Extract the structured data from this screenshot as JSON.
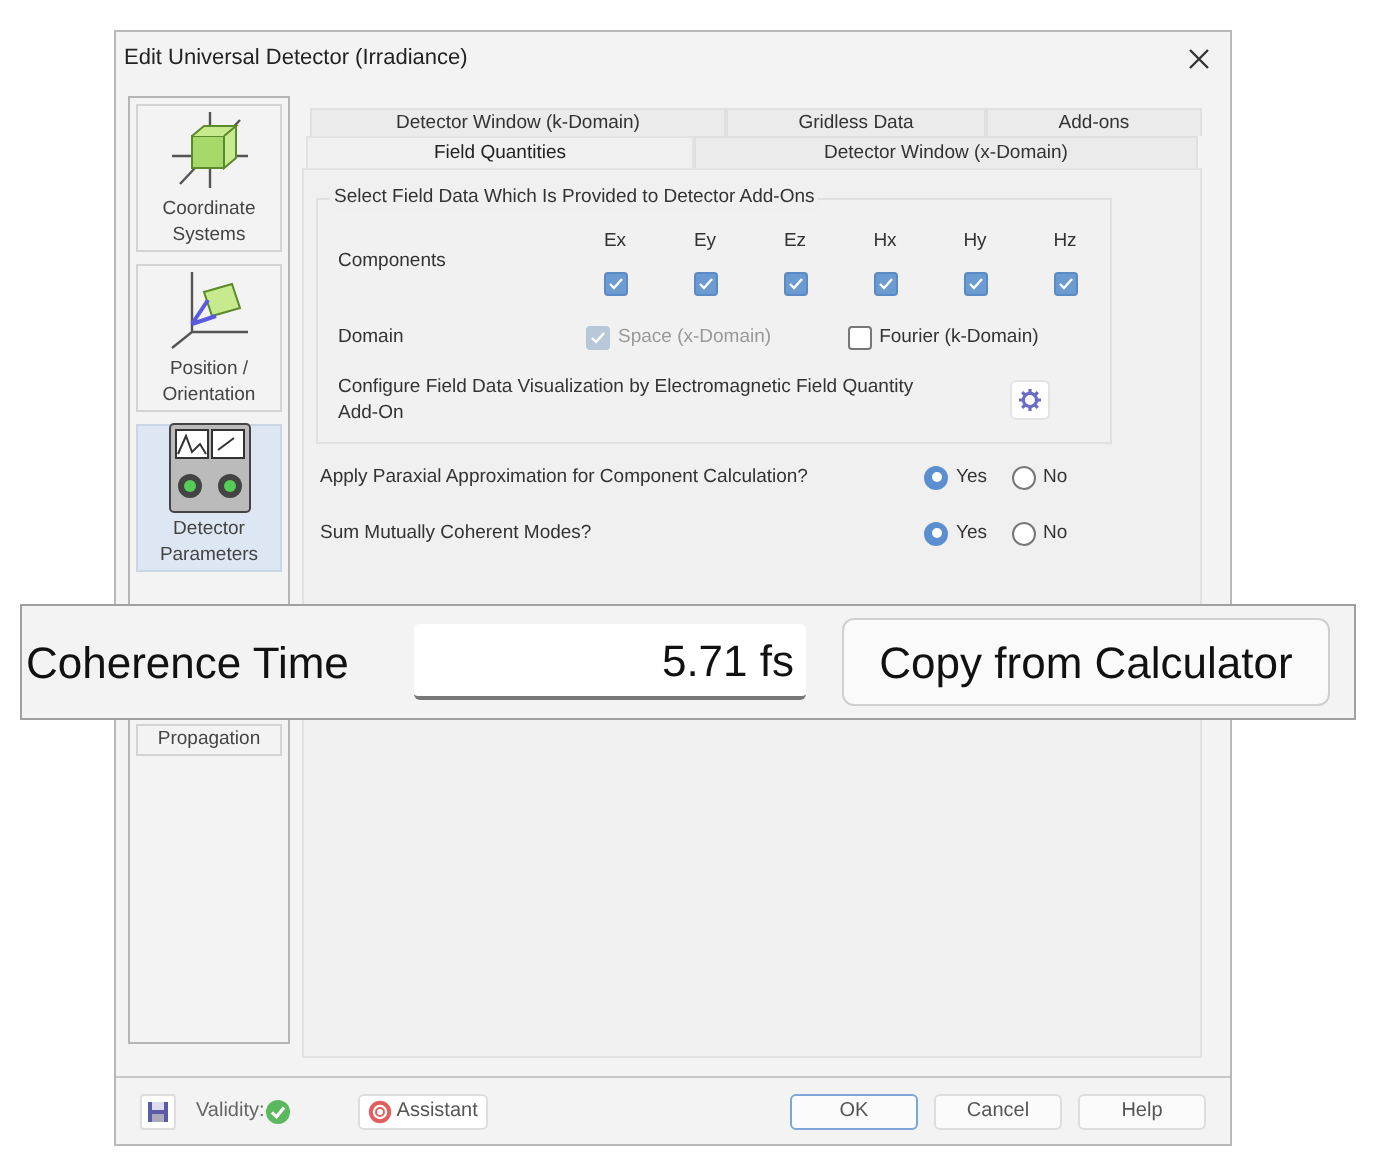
{
  "window": {
    "title": "Edit Universal Detector (Irradiance)"
  },
  "sidebar": {
    "items": [
      {
        "kind": "coordinates",
        "label": "Coordinate Systems",
        "selected": false
      },
      {
        "kind": "position",
        "label": "Position / Orientation",
        "selected": false
      },
      {
        "kind": "detector",
        "label": "Detector Parameters",
        "selected": true
      },
      {
        "kind": "propagation",
        "label": "Propagation",
        "selected": false
      }
    ]
  },
  "tab_rows": [
    {
      "tabs": [
        {
          "label": "Detector Window (k-Domain)",
          "selected": false
        },
        {
          "label": "Gridless Data",
          "selected": false
        },
        {
          "label": "Add-ons",
          "selected": false
        }
      ]
    },
    {
      "tabs": [
        {
          "label": "Field Quantities",
          "selected": true
        },
        {
          "label": "Detector Window (x-Domain)",
          "selected": false
        }
      ]
    }
  ],
  "field_group": {
    "title": "Select Field Data Which Is Provided to Detector Add-Ons",
    "components_label": "Components",
    "components": [
      {
        "label": "Ex",
        "checked": true
      },
      {
        "label": "Ey",
        "checked": true
      },
      {
        "label": "Ez",
        "checked": true
      },
      {
        "label": "Hx",
        "checked": true
      },
      {
        "label": "Hy",
        "checked": true
      },
      {
        "label": "Hz",
        "checked": true
      }
    ],
    "domain_label": "Domain",
    "domains": [
      {
        "label": "Space (x-Domain)",
        "checked": true,
        "disabled": true
      },
      {
        "label": "Fourier (k-Domain)",
        "checked": false,
        "disabled": false
      }
    ],
    "configure_text": "Configure Field Data Visualization by Electromagnetic Field Quantity Add-On"
  },
  "questions": [
    {
      "text": "Apply Paraxial Approximation for Component Calculation?",
      "options": [
        {
          "label": "Yes",
          "selected": true
        },
        {
          "label": "No",
          "selected": false
        }
      ]
    },
    {
      "text": "Sum Mutually Coherent Modes?",
      "options": [
        {
          "label": "Yes",
          "selected": true
        },
        {
          "label": "No",
          "selected": false
        }
      ]
    }
  ],
  "callout": {
    "label": "Coherence Time",
    "value": "5.71 fs",
    "button": "Copy from Calculator"
  },
  "footer": {
    "validity": "Validity:",
    "assistant": "Assistant",
    "buttons": [
      "OK",
      "Cancel",
      "Help"
    ]
  }
}
